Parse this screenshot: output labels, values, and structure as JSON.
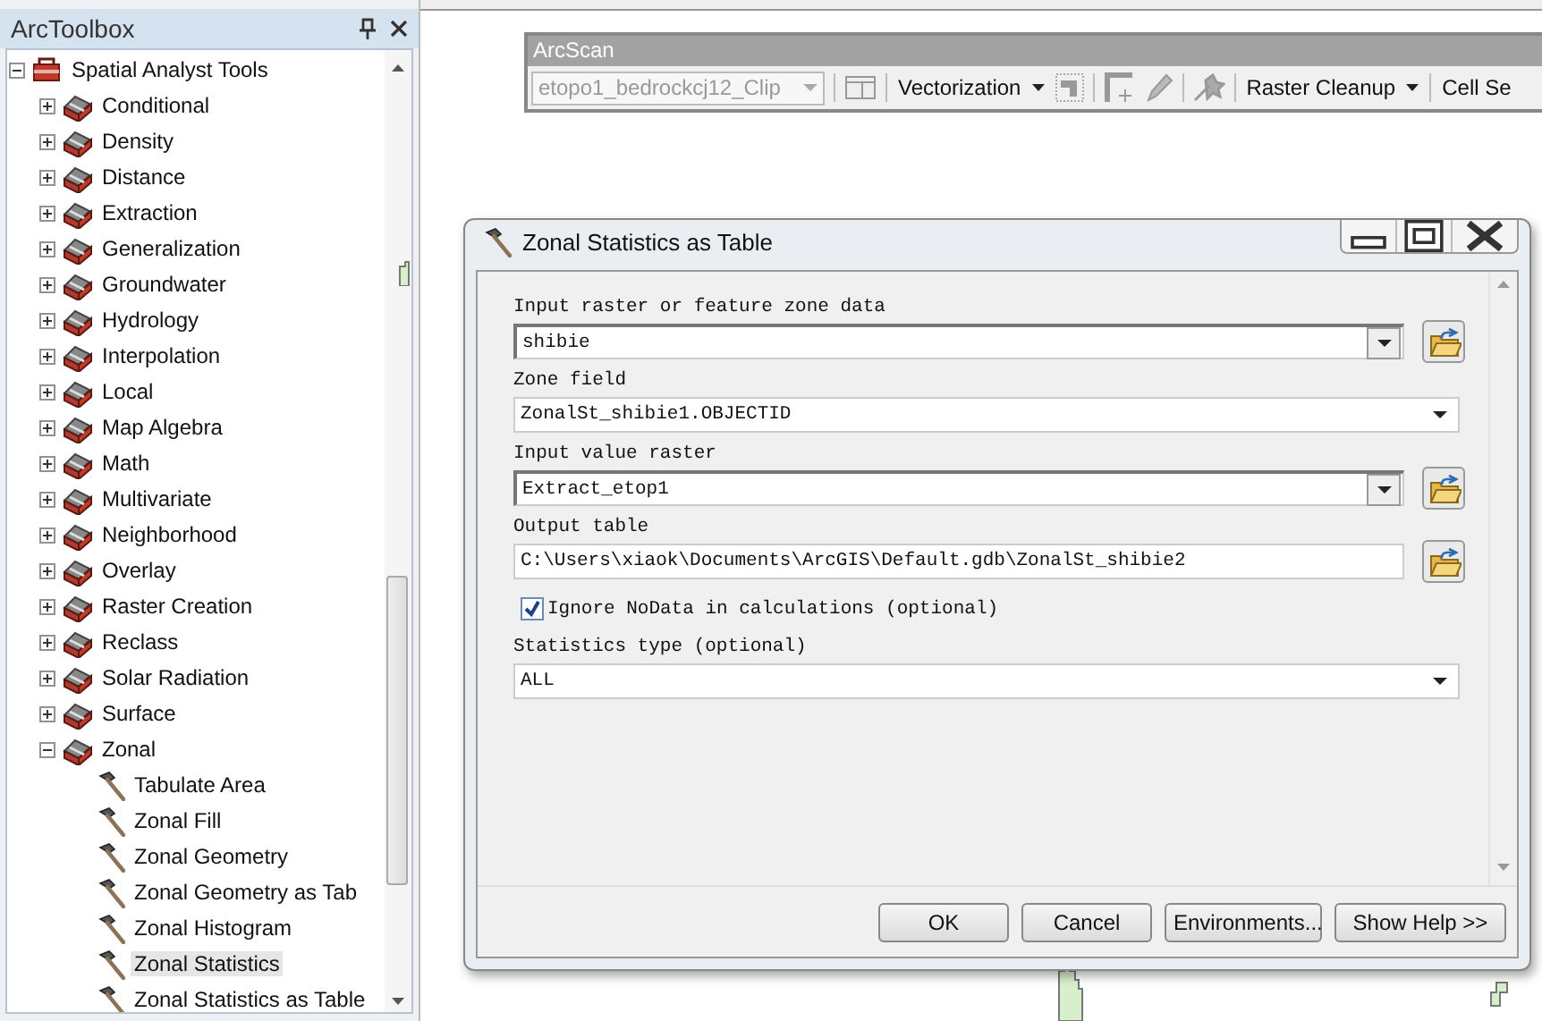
{
  "toolbox": {
    "title": "ArcToolbox",
    "root": {
      "label": "Spatial Analyst Tools",
      "expanded": true,
      "selected": false,
      "children": [
        {
          "label": "Conditional",
          "expanded": false,
          "selected": false
        },
        {
          "label": "Density",
          "expanded": false,
          "selected": false
        },
        {
          "label": "Distance",
          "expanded": false,
          "selected": false
        },
        {
          "label": "Extraction",
          "expanded": false,
          "selected": false
        },
        {
          "label": "Generalization",
          "expanded": false,
          "selected": false
        },
        {
          "label": "Groundwater",
          "expanded": false,
          "selected": false
        },
        {
          "label": "Hydrology",
          "expanded": false,
          "selected": false
        },
        {
          "label": "Interpolation",
          "expanded": false,
          "selected": false
        },
        {
          "label": "Local",
          "expanded": false,
          "selected": false
        },
        {
          "label": "Map Algebra",
          "expanded": false,
          "selected": false
        },
        {
          "label": "Math",
          "expanded": false,
          "selected": false
        },
        {
          "label": "Multivariate",
          "expanded": false,
          "selected": false
        },
        {
          "label": "Neighborhood",
          "expanded": false,
          "selected": false
        },
        {
          "label": "Overlay",
          "expanded": false,
          "selected": false
        },
        {
          "label": "Raster Creation",
          "expanded": false,
          "selected": false
        },
        {
          "label": "Reclass",
          "expanded": false,
          "selected": false
        },
        {
          "label": "Solar Radiation",
          "expanded": false,
          "selected": false
        },
        {
          "label": "Surface",
          "expanded": false,
          "selected": false
        },
        {
          "label": "Zonal",
          "expanded": true,
          "selected": false,
          "children": [
            {
              "label": "Tabulate Area",
              "selected": false
            },
            {
              "label": "Zonal Fill",
              "selected": false
            },
            {
              "label": "Zonal Geometry",
              "selected": false
            },
            {
              "label": "Zonal Geometry as Tab",
              "selected": false
            },
            {
              "label": "Zonal Histogram",
              "selected": false
            },
            {
              "label": "Zonal Statistics",
              "selected": true
            },
            {
              "label": "Zonal Statistics as Table",
              "selected": false
            }
          ]
        }
      ]
    }
  },
  "arcscan": {
    "title": "ArcScan",
    "layer": {
      "value": "etopo1_bedrockcj12_Clip",
      "disabled": true
    },
    "menus": [
      "Vectorization",
      "Raster Cleanup",
      "Cell Se"
    ]
  },
  "dialog": {
    "title": "Zonal Statistics as Table",
    "fields": [
      {
        "kind": "combo",
        "label": "Input raster or feature zone data",
        "value": "shibie"
      },
      {
        "kind": "dropdown",
        "label": "Zone field",
        "value": "ZonalSt_shibie1.OBJECTID"
      },
      {
        "kind": "combo",
        "label": "Input value raster",
        "value": "Extract_etop1"
      },
      {
        "kind": "text",
        "label": "Output table",
        "value": "C:\\Users\\xiaok\\Documents\\ArcGIS\\Default.gdb\\ZonalSt_shibie2"
      },
      {
        "kind": "checkbox",
        "label": "Ignore NoData in calculations (optional)",
        "checked": true
      },
      {
        "kind": "dropdown",
        "label": "Statistics type (optional)",
        "value": "ALL"
      }
    ],
    "buttons": [
      "OK",
      "Cancel",
      "Environments...",
      "Show Help >>"
    ]
  }
}
